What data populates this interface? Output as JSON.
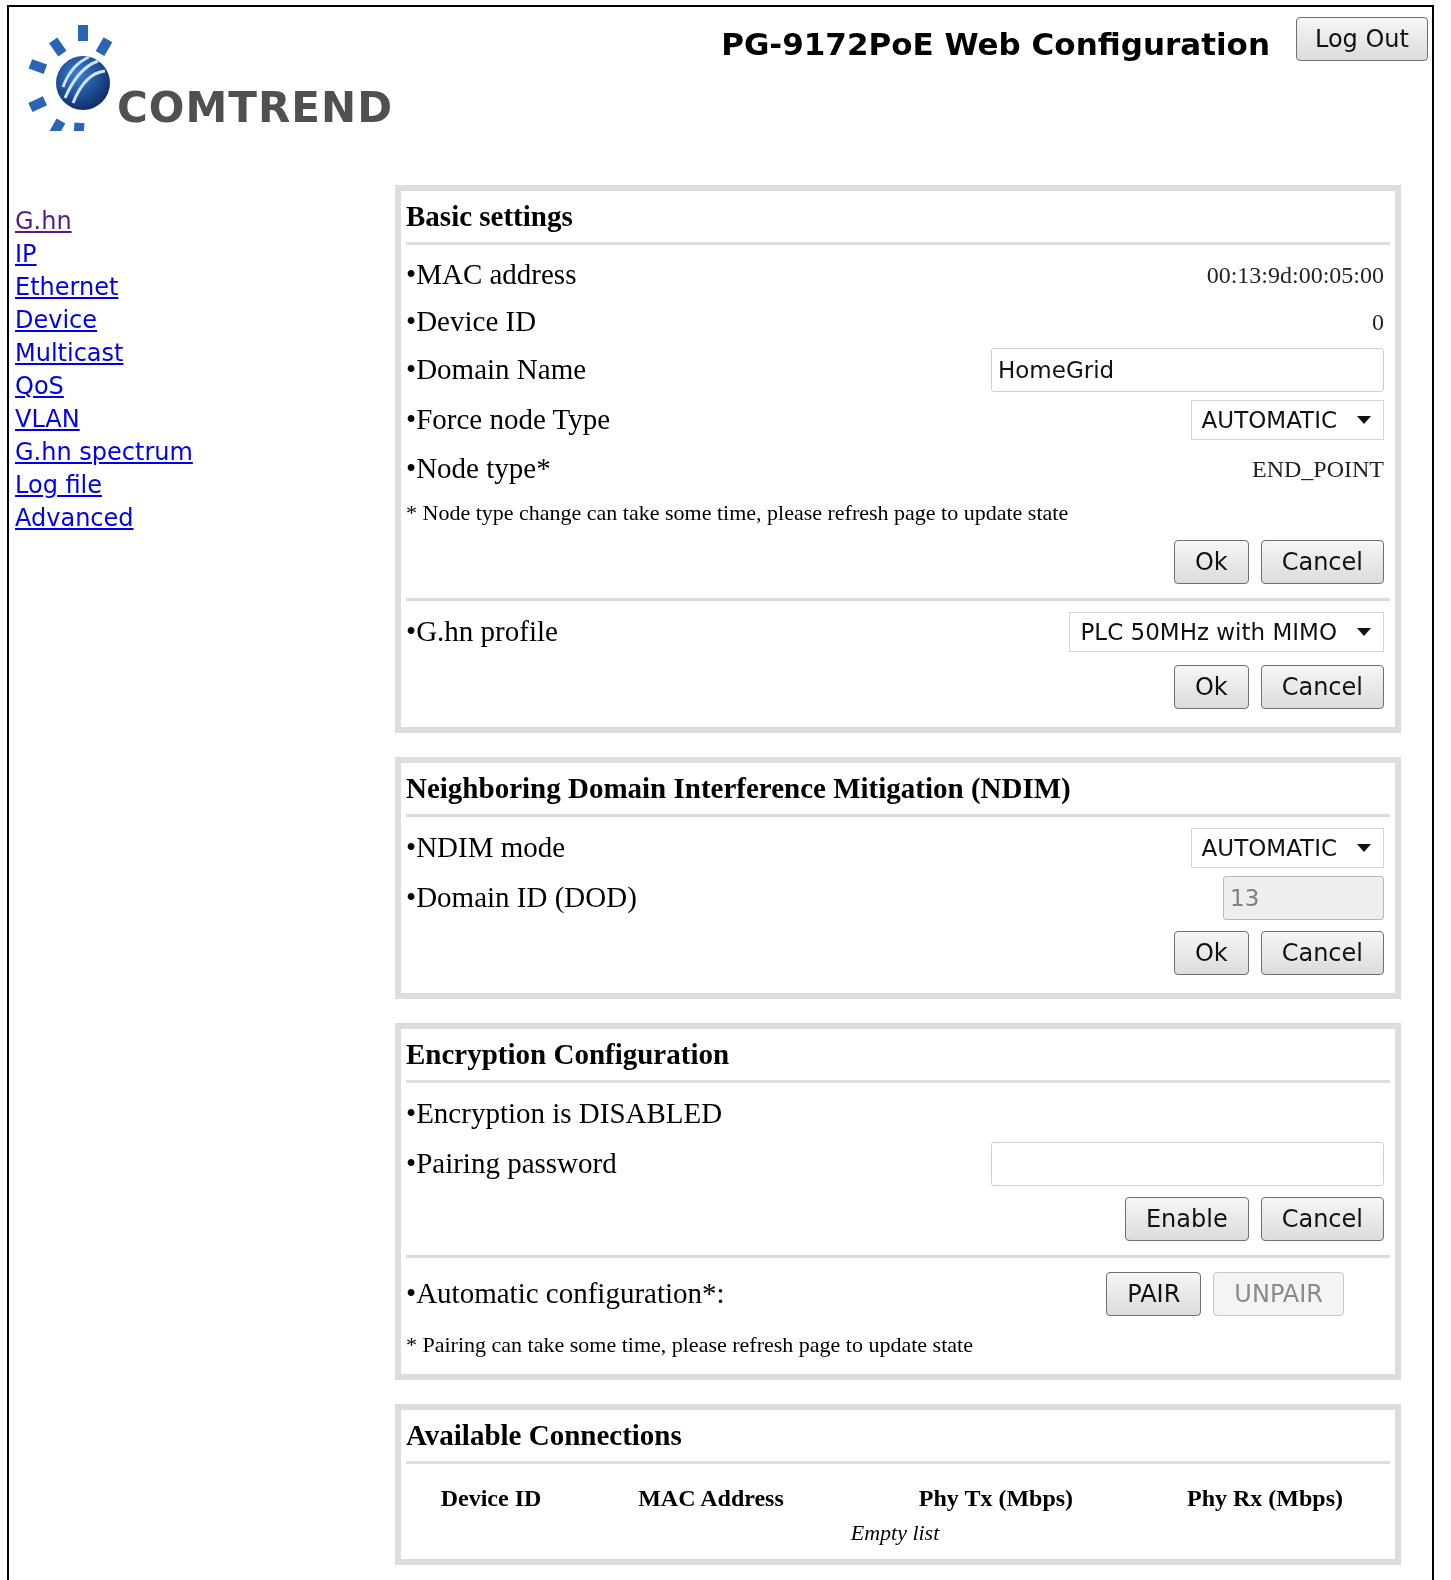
{
  "header": {
    "logo_text": "COMTREND",
    "title": "PG-9172PoE Web Configuration",
    "logout_button": "Log Out"
  },
  "nav": [
    {
      "label": "G.hn",
      "visited": true
    },
    {
      "label": "IP",
      "visited": false
    },
    {
      "label": "Ethernet",
      "visited": false
    },
    {
      "label": "Device",
      "visited": false
    },
    {
      "label": "Multicast",
      "visited": false
    },
    {
      "label": "QoS",
      "visited": false
    },
    {
      "label": "VLAN",
      "visited": false
    },
    {
      "label": "G.hn spectrum",
      "visited": false
    },
    {
      "label": "Log file",
      "visited": false
    },
    {
      "label": "Advanced",
      "visited": false
    }
  ],
  "sections": [
    {
      "title": "Basic settings",
      "blocks": [
        [
          {
            "kind": "value",
            "label": "•MAC address",
            "value": "00:13:9d:00:05:00"
          },
          {
            "kind": "value",
            "label": "•Device ID",
            "value": "0"
          },
          {
            "kind": "input",
            "label": "•Domain Name",
            "value": "HomeGrid",
            "disabled": false
          },
          {
            "kind": "select",
            "label": "•Force node Type",
            "value": "AUTOMATIC"
          },
          {
            "kind": "value",
            "label": "•Node type*",
            "value": "END_POINT"
          },
          {
            "kind": "note",
            "text": "* Node type change can take some time, please refresh page to update state"
          },
          {
            "kind": "buttons",
            "buttons": [
              {
                "label": "Ok",
                "disabled": false
              },
              {
                "label": "Cancel",
                "disabled": false
              }
            ]
          }
        ],
        [
          {
            "kind": "select",
            "label": "•G.hn profile",
            "value": "PLC 50MHz with MIMO"
          },
          {
            "kind": "buttons",
            "buttons": [
              {
                "label": "Ok",
                "disabled": false
              },
              {
                "label": "Cancel",
                "disabled": false
              }
            ]
          }
        ]
      ]
    },
    {
      "title": "Neighboring Domain Interference Mitigation (NDIM)",
      "blocks": [
        [
          {
            "kind": "select",
            "label": "•NDIM mode",
            "value": "AUTOMATIC"
          },
          {
            "kind": "short_input",
            "label": "•Domain ID (DOD)",
            "value": "13",
            "disabled": true
          },
          {
            "kind": "buttons",
            "buttons": [
              {
                "label": "Ok",
                "disabled": false
              },
              {
                "label": "Cancel",
                "disabled": false
              }
            ]
          }
        ]
      ]
    },
    {
      "title": "Encryption Configuration",
      "blocks": [
        [
          {
            "kind": "label",
            "label": "•Encryption is DISABLED"
          },
          {
            "kind": "input",
            "label": "•Pairing password",
            "disabled": false
          },
          {
            "kind": "buttons",
            "buttons": [
              {
                "label": "Enable",
                "disabled": false
              },
              {
                "label": "Cancel",
                "disabled": false
              }
            ]
          }
        ],
        [
          {
            "kind": "label_buttons",
            "label": "•Automatic configuration*:",
            "buttons": [
              {
                "label": "PAIR",
                "disabled": false
              },
              {
                "label": "UNPAIR",
                "disabled": true
              }
            ]
          },
          {
            "kind": "note",
            "text": "* Pairing can take some time, please refresh page to update state"
          }
        ]
      ]
    },
    {
      "title": "Available Connections",
      "blocks": [
        [
          {
            "kind": "table",
            "columns": [
              "Device ID",
              "MAC Address",
              "Phy Tx (Mbps)",
              "Phy Rx (Mbps)"
            ],
            "empty_text": "Empty list"
          }
        ]
      ]
    }
  ]
}
